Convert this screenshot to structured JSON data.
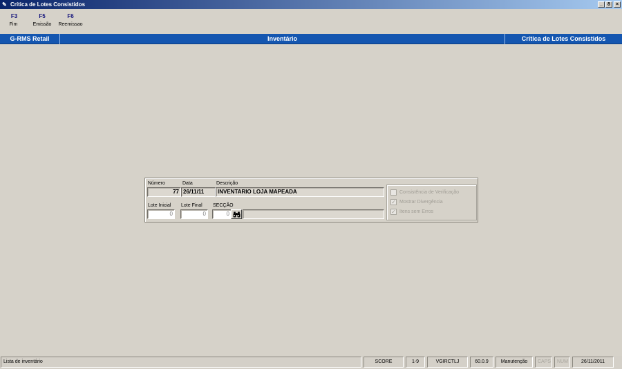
{
  "window": {
    "title": "Crítica de Lotes Consistidos",
    "controls": {
      "minimize": "_",
      "restore": "8",
      "close": "×"
    }
  },
  "toolbar": {
    "keys": [
      {
        "key": "F3",
        "label": "Fim"
      },
      {
        "key": "F5",
        "label": "Emissão"
      },
      {
        "key": "F6",
        "label": "Reemissao"
      }
    ]
  },
  "header": {
    "app": "G-RMS Retail",
    "module": "Inventário",
    "screen": "Crítica de Lotes Consistidos"
  },
  "form": {
    "numero_label": "Número",
    "numero_value": "77",
    "data_label": "Data",
    "data_value": "26/11/11",
    "descricao_label": "Descrição",
    "descricao_value": "INVENTARIO LOJA MAPEADA",
    "lote_inicial_label": "Lote Inicial",
    "lote_inicial_value": "0",
    "lote_final_label": "Lote Final",
    "lote_final_value": "0",
    "seccao_label": "SECÇÃO",
    "seccao_value": "0",
    "seccao_desc_value": ""
  },
  "options": [
    {
      "label": "Consistência de Verificação",
      "checked": false
    },
    {
      "label": "Mostrar Divergência",
      "checked": true
    },
    {
      "label": "Itens sem Erros",
      "checked": true
    }
  ],
  "status": {
    "message": "Lista de inventário",
    "user": "SCORE",
    "session": "1-9",
    "program": "VGIRCTLJ",
    "version": "60.0.9",
    "mode": "Manutenção",
    "caps": "CAPS",
    "num": "NUM",
    "date": "26/11/2011"
  }
}
